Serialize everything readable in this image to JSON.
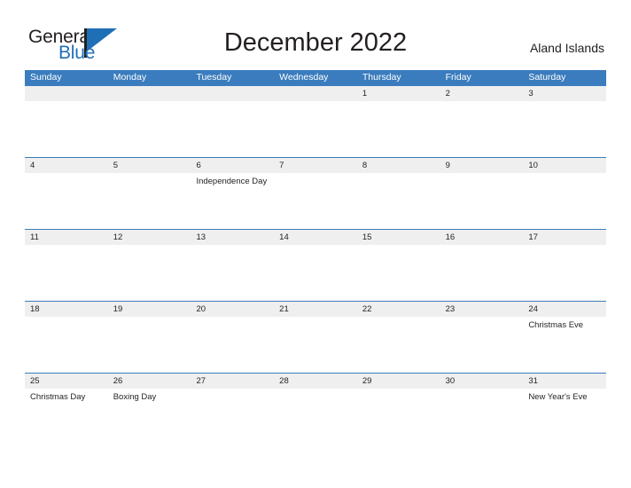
{
  "brand": {
    "name_part1": "General",
    "name_part2": "Blue",
    "accent_color": "#1f6fb7"
  },
  "header": {
    "title": "December 2022",
    "region": "Aland Islands"
  },
  "theme": {
    "header_blue": "#3a7cbd",
    "row_shade": "#efefef",
    "text_color": "#231f20"
  },
  "calendar": {
    "weekdays": [
      "Sunday",
      "Monday",
      "Tuesday",
      "Wednesday",
      "Thursday",
      "Friday",
      "Saturday"
    ],
    "weeks": [
      [
        {
          "day": "",
          "event": ""
        },
        {
          "day": "",
          "event": ""
        },
        {
          "day": "",
          "event": ""
        },
        {
          "day": "",
          "event": ""
        },
        {
          "day": "1",
          "event": ""
        },
        {
          "day": "2",
          "event": ""
        },
        {
          "day": "3",
          "event": ""
        }
      ],
      [
        {
          "day": "4",
          "event": ""
        },
        {
          "day": "5",
          "event": ""
        },
        {
          "day": "6",
          "event": "Independence Day"
        },
        {
          "day": "7",
          "event": ""
        },
        {
          "day": "8",
          "event": ""
        },
        {
          "day": "9",
          "event": ""
        },
        {
          "day": "10",
          "event": ""
        }
      ],
      [
        {
          "day": "11",
          "event": ""
        },
        {
          "day": "12",
          "event": ""
        },
        {
          "day": "13",
          "event": ""
        },
        {
          "day": "14",
          "event": ""
        },
        {
          "day": "15",
          "event": ""
        },
        {
          "day": "16",
          "event": ""
        },
        {
          "day": "17",
          "event": ""
        }
      ],
      [
        {
          "day": "18",
          "event": ""
        },
        {
          "day": "19",
          "event": ""
        },
        {
          "day": "20",
          "event": ""
        },
        {
          "day": "21",
          "event": ""
        },
        {
          "day": "22",
          "event": ""
        },
        {
          "day": "23",
          "event": ""
        },
        {
          "day": "24",
          "event": "Christmas Eve"
        }
      ],
      [
        {
          "day": "25",
          "event": "Christmas Day"
        },
        {
          "day": "26",
          "event": "Boxing Day"
        },
        {
          "day": "27",
          "event": ""
        },
        {
          "day": "28",
          "event": ""
        },
        {
          "day": "29",
          "event": ""
        },
        {
          "day": "30",
          "event": ""
        },
        {
          "day": "31",
          "event": "New Year's Eve"
        }
      ]
    ]
  }
}
